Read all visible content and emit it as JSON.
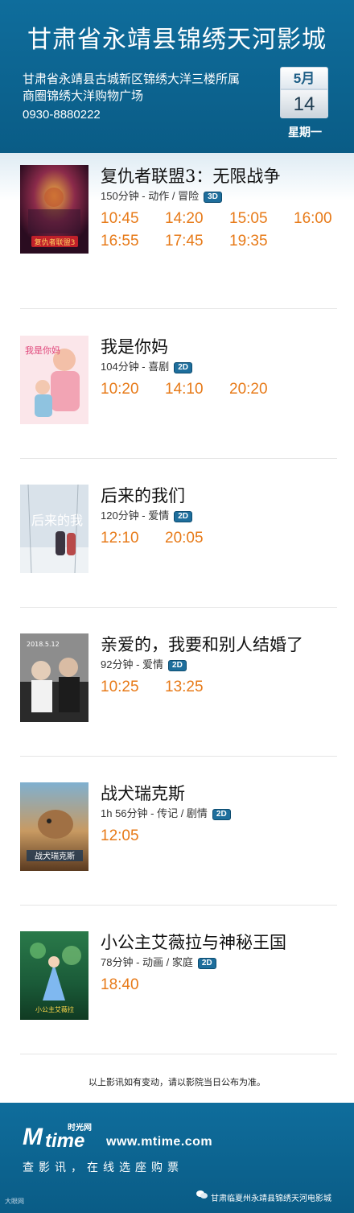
{
  "header": {
    "cinema_name": "甘肃省永靖县锦绣天河影城",
    "address": "甘肃省永靖县古城新区锦绣大洋三楼所属\n商圈锦绣大洋购物广场",
    "phone": "0930-8880222",
    "month": "5月",
    "day": "14",
    "weekday": "星期一"
  },
  "movies": [
    {
      "title": "复仇者联盟3：无限战争",
      "meta": "150分钟 - 动作 / 冒险",
      "format": "3D",
      "times": [
        "10:45",
        "14:20",
        "15:05",
        "16:00",
        "16:55",
        "17:45",
        "19:35"
      ]
    },
    {
      "title": "我是你妈",
      "meta": "104分钟 - 喜剧",
      "format": "2D",
      "times": [
        "10:20",
        "14:10",
        "20:20"
      ]
    },
    {
      "title": "后来的我们",
      "meta": "120分钟 - 爱情",
      "format": "2D",
      "times": [
        "12:10",
        "20:05"
      ]
    },
    {
      "title": "亲爱的，我要和别人结婚了",
      "meta": "92分钟 - 爱情",
      "format": "2D",
      "times": [
        "10:25",
        "13:25"
      ]
    },
    {
      "title": "战犬瑞克斯",
      "meta": "1h 56分钟 - 传记 / 剧情",
      "format": "2D",
      "times": [
        "12:05"
      ]
    },
    {
      "title": "小公主艾薇拉与神秘王国",
      "meta": "78分钟 - 动画 / 家庭",
      "format": "2D",
      "times": [
        "18:40"
      ]
    }
  ],
  "posters": {
    "p0": "复仇者联盟3",
    "p1": "我是你妈",
    "p2": "后来的我",
    "p3": "2018.5.12",
    "p4": "战犬瑞克斯",
    "p5": "小公主艾薇拉"
  },
  "notice": "以上影讯如有变动，请以影院当日公布为准。",
  "footer": {
    "logo_m": "M",
    "logo_time": "time",
    "logo_cn": "时光网",
    "url": "www.mtime.com",
    "slogan": "查影讯，在线选座购票",
    "wechat": "甘肃临夏州永靖县锦绣天河电影城",
    "watermark": "大眼网"
  },
  "colors": {
    "header_blue": "#0a5c86",
    "showtime_orange": "#e77a18",
    "badge_blue": "#1e6e9c"
  }
}
